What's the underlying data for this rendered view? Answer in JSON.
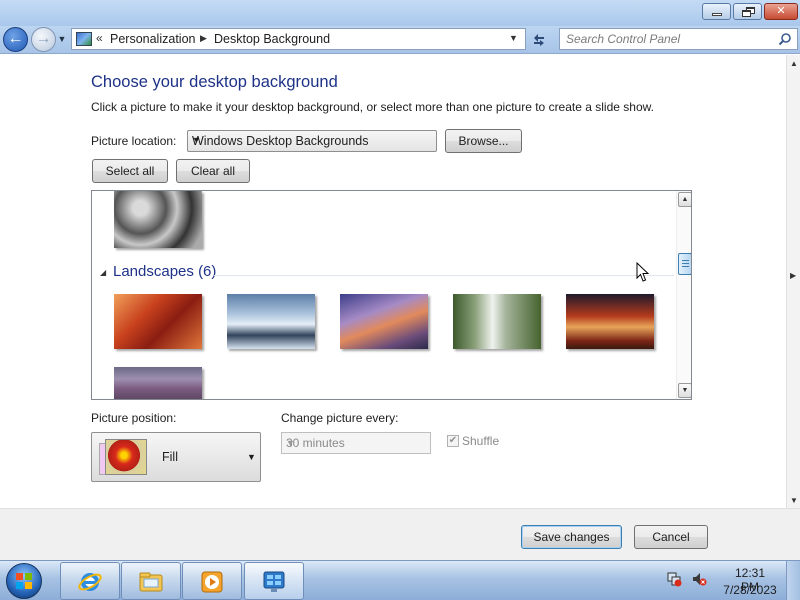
{
  "window": {
    "minimize_icon": "minimize-icon",
    "maximize_icon": "restore-icon",
    "close_glyph": "✕"
  },
  "nav": {
    "back_glyph": "←",
    "forward_glyph": "→",
    "breadcrumb": [
      "Personalization",
      "Desktop Background"
    ],
    "search_placeholder": "Search Control Panel"
  },
  "main": {
    "title": "Choose your desktop background",
    "description": "Click a picture to make it your desktop background, or select more than one picture to create a slide show.",
    "picture_location_label": "Picture location:",
    "picture_location_value": "Windows Desktop Backgrounds",
    "browse_label": "Browse...",
    "select_all_label": "Select all",
    "clear_all_label": "Clear all",
    "gallery": {
      "group_title": "Landscapes (6)",
      "scroll_position": 0.38
    },
    "picture_position_label": "Picture position:",
    "picture_position_value": "Fill",
    "change_every_label": "Change picture every:",
    "change_every_value": "30 minutes",
    "shuffle_label": "Shuffle",
    "shuffle_checked": true
  },
  "footer": {
    "save_label": "Save changes",
    "cancel_label": "Cancel"
  },
  "taskbar": {
    "apps": [
      "internet-explorer-icon",
      "windows-explorer-icon",
      "media-player-icon",
      "control-panel-icon"
    ],
    "time": "12:31 PM",
    "date": "7/28/2023"
  },
  "colors": {
    "title_blue": "#1e3287",
    "accent_button_border": "#3c7fb1"
  }
}
